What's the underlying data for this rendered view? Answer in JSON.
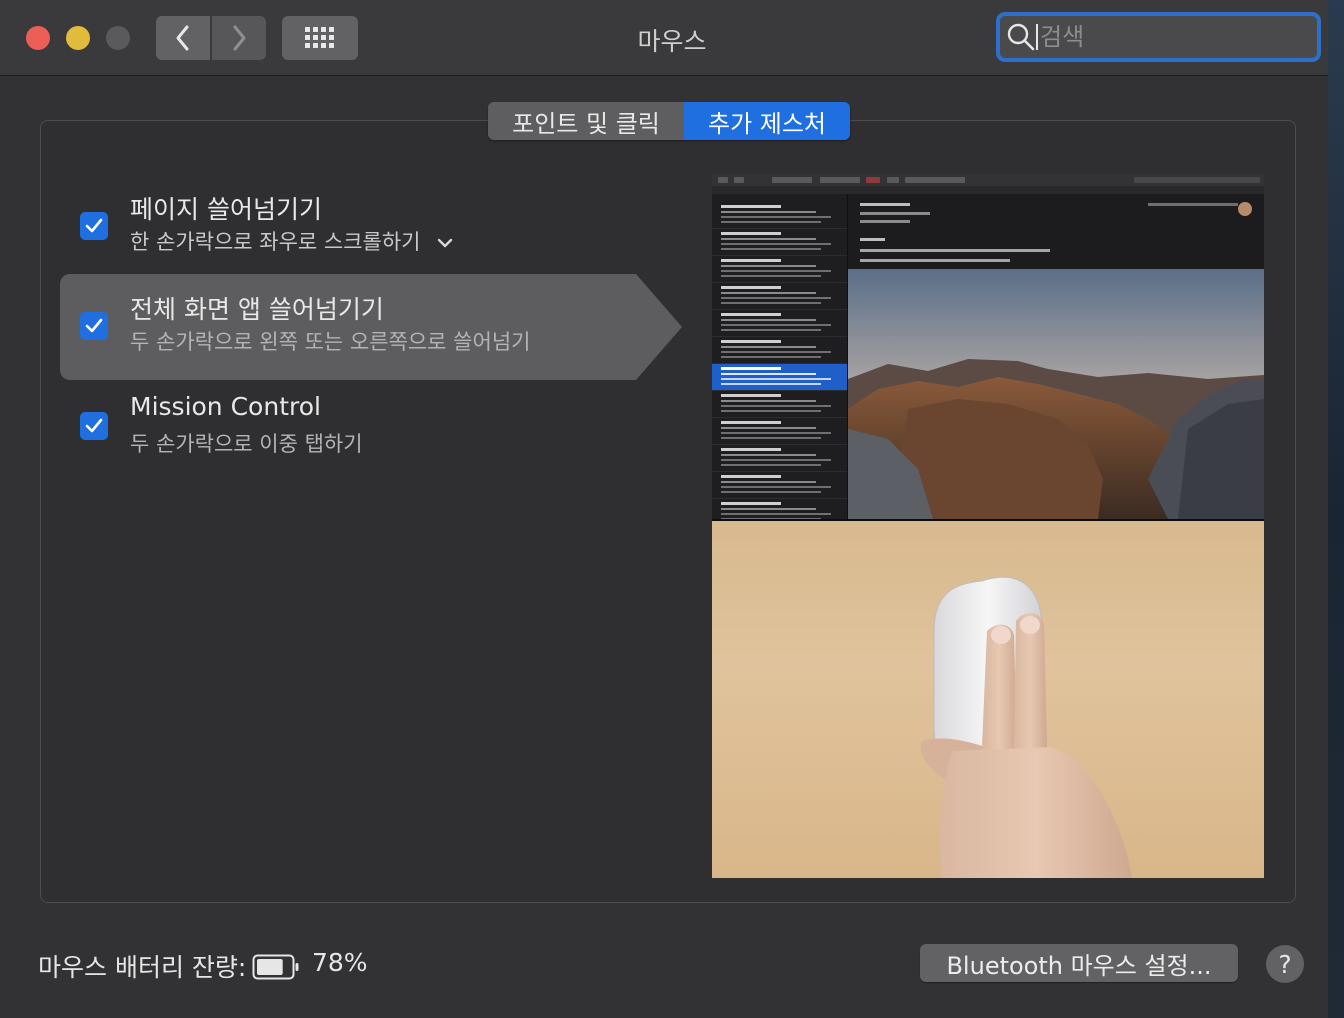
{
  "window": {
    "title": "마우스",
    "search_placeholder": "검색"
  },
  "tabs": [
    {
      "label": "포인트 및 클릭",
      "selected": false
    },
    {
      "label": "추가 제스처",
      "selected": true
    }
  ],
  "options": [
    {
      "title": "페이지 쓸어넘기기",
      "subtitle": "한 손가락으로 좌우로 스크롤하기",
      "checked": true,
      "has_dropdown": true
    },
    {
      "title": "전체 화면 앱 쓸어넘기기",
      "subtitle": "두 손가락으로 왼쪽 또는 오른쪽으로 쓸어넘기",
      "checked": true,
      "selected": true
    },
    {
      "title": "Mission Control",
      "subtitle": "두 손가락으로 이중 탭하기",
      "checked": true
    }
  ],
  "footer": {
    "battery_label": "마우스 배터리 잔량:",
    "battery_percent": "78%",
    "battery_level": 0.78,
    "bluetooth_button": "Bluetooth 마우스 설정...",
    "help_label": "?"
  },
  "colors": {
    "accent": "#1f6fe0",
    "close": "#ec5f57",
    "minimize": "#e0bb3c",
    "window_bg": "#323234"
  },
  "icons": [
    "back-chevron-icon",
    "forward-chevron-icon",
    "grid-icon",
    "search-icon",
    "checkmark-icon",
    "chevron-down-icon",
    "battery-icon"
  ]
}
